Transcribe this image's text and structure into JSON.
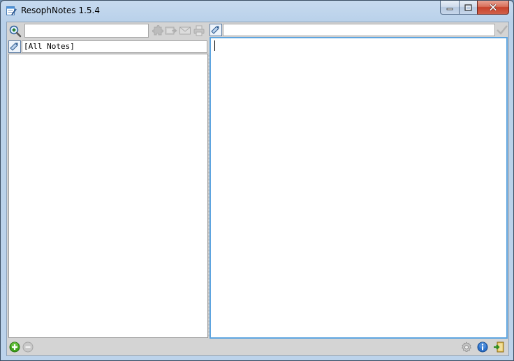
{
  "window": {
    "title": "ResophNotes 1.5.4"
  },
  "toolbar": {
    "search_value": "",
    "tags_value": ""
  },
  "notes_panel": {
    "filter_label": "[All Notes]",
    "items": []
  },
  "editor": {
    "content": ""
  },
  "colors": {
    "accent": "#5ea5e0",
    "client_bg": "#d4d4d4",
    "add_green": "#3fa31c",
    "info_blue": "#2a6fc9"
  },
  "icons": {
    "search": "search-plus-icon",
    "puzzle": "puzzle-icon",
    "export": "export-icon",
    "email": "email-icon",
    "print": "print-icon",
    "tag": "tag-icon",
    "check": "check-icon",
    "add": "add-note-icon",
    "remove": "remove-note-icon",
    "settings": "gear-icon",
    "info": "info-icon",
    "exit": "exit-icon"
  }
}
